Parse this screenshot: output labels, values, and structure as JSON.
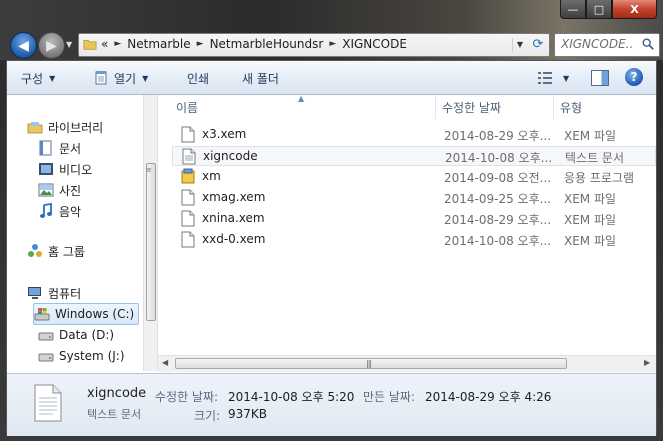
{
  "window": {
    "minimize_glyph": "—",
    "maximize_glyph": "□",
    "close_glyph": "X"
  },
  "address": {
    "overflow": "«",
    "breadcrumbs": [
      "Netmarble",
      "NetmarbleHoundsr",
      "XIGNCODE"
    ],
    "separator": "►"
  },
  "search": {
    "placeholder": "XIGNCODE..."
  },
  "toolbar": {
    "organize": "구성",
    "open": "열기",
    "print": "인쇄",
    "new_folder": "새 폴더"
  },
  "nav": {
    "libraries": "라이브러리",
    "documents": "문서",
    "videos": "비디오",
    "pictures": "사진",
    "music": "음악",
    "homegroup": "홈 그룹",
    "computer": "컴퓨터",
    "drive_c": "Windows (C:)",
    "drive_d": "Data (D:)",
    "drive_j": "System (J:)"
  },
  "columns": {
    "name": "이름",
    "modified": "수정한 날짜",
    "type": "유형"
  },
  "files": [
    {
      "name": "x3.xem",
      "modified": "2014-08-29 오후...",
      "type": "XEM 파일",
      "icon": "file-icon"
    },
    {
      "name": "xigncode",
      "modified": "2014-10-08 오후...",
      "type": "텍스트 문서",
      "icon": "text-file-icon"
    },
    {
      "name": "xm",
      "modified": "2014-09-08 오전...",
      "type": "응용 프로그램",
      "icon": "application-icon"
    },
    {
      "name": "xmag.xem",
      "modified": "2014-09-25 오후...",
      "type": "XEM 파일",
      "icon": "file-icon"
    },
    {
      "name": "xnina.xem",
      "modified": "2014-08-29 오후...",
      "type": "XEM 파일",
      "icon": "file-icon"
    },
    {
      "name": "xxd-0.xem",
      "modified": "2014-10-08 오후...",
      "type": "XEM 파일",
      "icon": "file-icon"
    }
  ],
  "details": {
    "name": "xigncode",
    "type": "텍스트 문서",
    "modified_label": "수정한 날짜:",
    "modified_value": "2014-10-08 오후 5:20",
    "created_label": "만든 날짜:",
    "created_value": "2014-08-29 오후 4:26",
    "size_label": "크기:",
    "size_value": "937KB"
  },
  "colors": {
    "accent": "#2a6fc1",
    "selection_border": "#9bc0ea",
    "close_red": "#c3432e"
  }
}
